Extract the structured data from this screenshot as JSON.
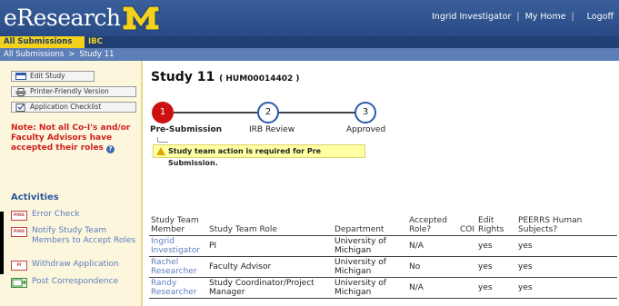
{
  "header": {
    "logo_text": "eResearch",
    "logo_letter": "M",
    "user_name": "Ingrid Investigator",
    "my_home": "My Home",
    "logoff": "Logoff",
    "separator": "|"
  },
  "tabs": {
    "all_submissions": "All Submissions",
    "irb": "IBC"
  },
  "breadcrumb": {
    "root": "All Submissions",
    "separator": ">",
    "current": "Study 11"
  },
  "sidebar": {
    "edit_study": "Edit Study",
    "printer_friendly": "Printer-Friendly Version",
    "application_checklist": "Application Checklist",
    "note": "Note: Not all Co-I's and/or Faculty Advisors have accepted their roles",
    "activities_title": "Activities",
    "activities": [
      {
        "label": "Error Check",
        "badge": "PINS"
      },
      {
        "label": "Notify Study Team Members to Accept Roles",
        "badge": "PINS"
      },
      {
        "label": "Withdraw Application",
        "badge": "PI"
      },
      {
        "label": "Post Correspondence",
        "badge": ""
      }
    ]
  },
  "study": {
    "title": "Study 11",
    "id": "( HUM00014402 )"
  },
  "steps": [
    {
      "number": "1",
      "label": "Pre-Submission",
      "active": true
    },
    {
      "number": "2",
      "label": "IRB Review",
      "active": false
    },
    {
      "number": "3",
      "label": "Approved",
      "active": false
    }
  ],
  "warning": "Study team action is required for Pre Submission.",
  "team_table": {
    "headers": [
      "Study Team Member",
      "Study Team Role",
      "Department",
      "Accepted Role?",
      "COI",
      "Edit Rights",
      "PEERRS Human Subjects?"
    ],
    "rows": [
      {
        "member": "Ingrid Investigator",
        "role": "PI",
        "department": "University of Michigan",
        "accepted": "N/A",
        "coi": "",
        "edit": "yes",
        "peerrs": "yes"
      },
      {
        "member": "Rachel Researcher",
        "role": "Faculty Advisor",
        "department": "University of Michigan",
        "accepted": "No",
        "coi": "",
        "edit": "yes",
        "peerrs": "yes"
      },
      {
        "member": "Randy Researcher",
        "role": "Study Coordinator/Project Manager",
        "department": "University of Michigan",
        "accepted": "N/A",
        "coi": "",
        "edit": "yes",
        "peerrs": "yes"
      }
    ]
  },
  "colors": {
    "header_blue": "#2f5490",
    "tab_yellow": "#f4d21c",
    "note_red": "#d01f1f",
    "active_step_red": "#cc1111",
    "link_blue": "#5f7ec0"
  }
}
